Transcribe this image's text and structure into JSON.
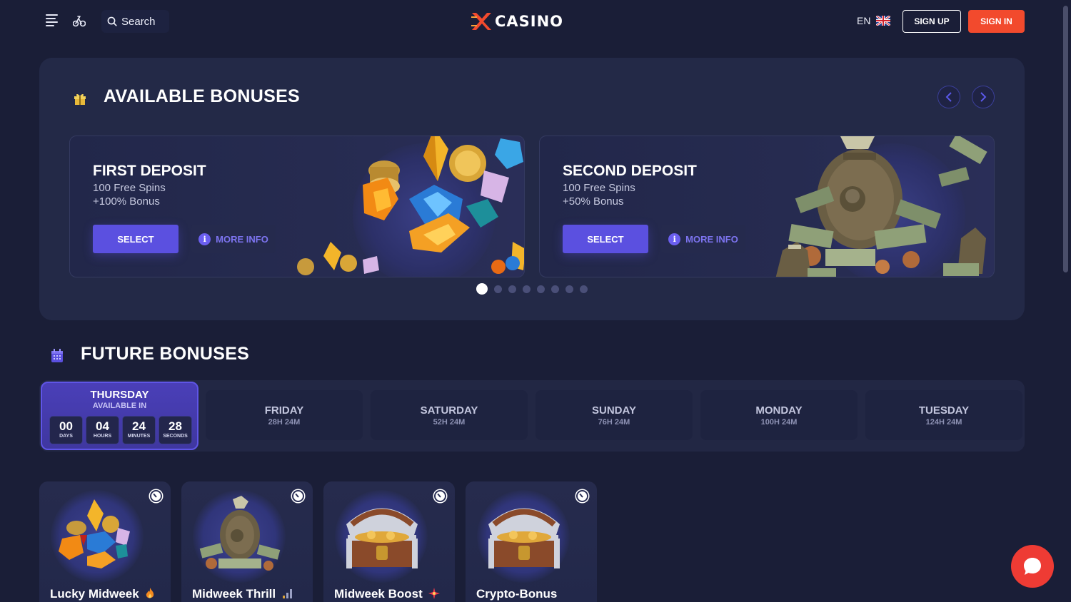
{
  "header": {
    "search_label": "Search",
    "logo_text": "CASINO",
    "language": "EN",
    "signup_label": "SIGN UP",
    "signin_label": "SIGN IN",
    "signin_color": "#f24a2d"
  },
  "available": {
    "title": "AVAILABLE BONUSES",
    "cards": [
      {
        "title": "FIRST DEPOSIT",
        "line1": "100 Free Spins",
        "line2": "+100% Bonus",
        "select_label": "SELECT",
        "more_label": "MORE INFO",
        "art": "gems-and-coins"
      },
      {
        "title": "SECOND DEPOSIT",
        "line1": "100 Free Spins",
        "line2": "+50% Bonus",
        "select_label": "SELECT",
        "more_label": "MORE INFO",
        "art": "money-bags"
      }
    ],
    "pagination": {
      "total": 8,
      "current": 1
    }
  },
  "future": {
    "title": "FUTURE BONUSES",
    "active_day": {
      "day": "THURSDAY",
      "label": "AVAILABLE IN",
      "countdown": [
        {
          "value": "00",
          "unit": "DAYS"
        },
        {
          "value": "04",
          "unit": "HOURS"
        },
        {
          "value": "24",
          "unit": "MINUTES"
        },
        {
          "value": "28",
          "unit": "SECONDS"
        }
      ]
    },
    "days": [
      {
        "day": "FRIDAY",
        "time": "28H 24M"
      },
      {
        "day": "SATURDAY",
        "time": "52H 24M"
      },
      {
        "day": "SUNDAY",
        "time": "76H 24M"
      },
      {
        "day": "MONDAY",
        "time": "100H 24M"
      },
      {
        "day": "TUESDAY",
        "time": "124H 24M"
      }
    ]
  },
  "tiles": [
    {
      "name": "Lucky Midweek",
      "icon": "fire-icon",
      "art": "gems"
    },
    {
      "name": "Midweek Thrill",
      "icon": "signal-icon",
      "art": "money-bag"
    },
    {
      "name": "Midweek Boost",
      "icon": "sparkle-icon",
      "art": "treasure-chest"
    },
    {
      "name": "Crypto-Bonus",
      "icon": "",
      "art": "treasure-chest"
    }
  ],
  "accent_color": "#5b50e0"
}
